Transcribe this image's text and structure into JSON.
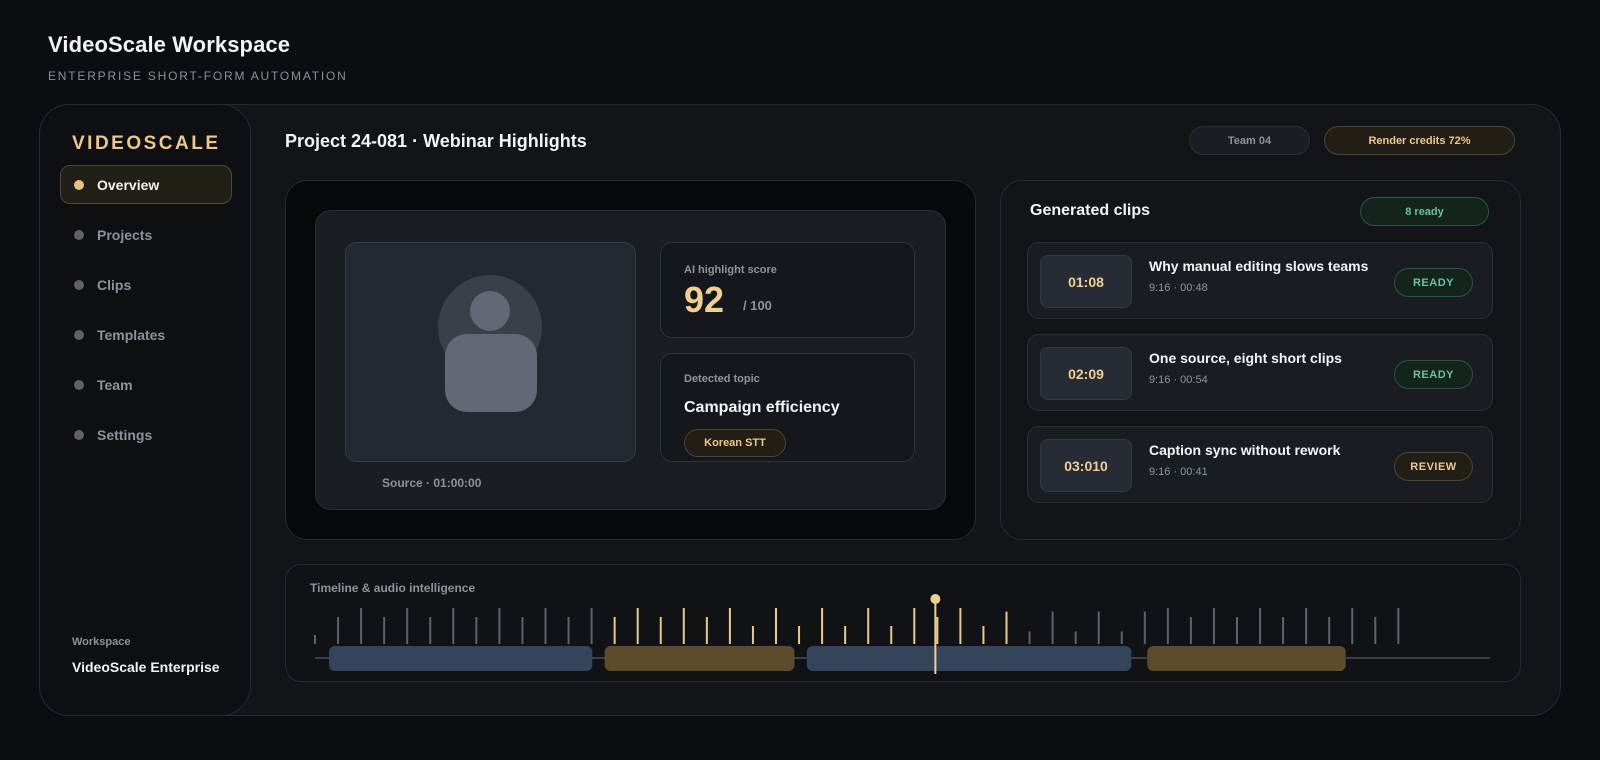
{
  "header": {
    "title": "VideoScale Workspace",
    "subtitle": "ENTERPRISE SHORT-FORM AUTOMATION"
  },
  "sidebar": {
    "brand": "VIDEOSCALE",
    "items": [
      {
        "label": "Overview",
        "active": true
      },
      {
        "label": "Projects",
        "active": false
      },
      {
        "label": "Clips",
        "active": false
      },
      {
        "label": "Templates",
        "active": false
      },
      {
        "label": "Team",
        "active": false
      },
      {
        "label": "Settings",
        "active": false
      }
    ],
    "workspace_label": "Workspace",
    "workspace_name": "VideoScale Enterprise"
  },
  "project": {
    "title": "Project 24-081 · Webinar Highlights",
    "team": "Team 04",
    "credits": "Render credits 72%",
    "source": "Source · 01:00:00",
    "score_label": "AI highlight score",
    "score_value": "92",
    "score_max": "/ 100",
    "topic_label": "Detected topic",
    "topic_value": "Campaign efficiency",
    "topic_chip": "Korean STT"
  },
  "clips": {
    "title": "Generated clips",
    "ready_badge": "8 ready",
    "items": [
      {
        "time": "01:08",
        "title": "Why manual editing slows teams",
        "meta": "9:16 · 00:48",
        "status": "READY",
        "status_kind": "ready"
      },
      {
        "time": "02:09",
        "title": "One source, eight short clips",
        "meta": "9:16 · 00:54",
        "status": "READY",
        "status_kind": "ready"
      },
      {
        "time": "03:010",
        "title": "Caption sync without rework",
        "meta": "9:16 · 00:41",
        "status": "REVIEW",
        "status_kind": "review"
      }
    ]
  },
  "timeline": {
    "title": "Timeline & audio intelligence",
    "bars": [
      {
        "level": 0.25,
        "highlight": false
      },
      {
        "level": 0.75,
        "highlight": false
      },
      {
        "level": 1.0,
        "highlight": false
      },
      {
        "level": 0.75,
        "highlight": false
      },
      {
        "level": 1.0,
        "highlight": false
      },
      {
        "level": 0.75,
        "highlight": false
      },
      {
        "level": 1.0,
        "highlight": false
      },
      {
        "level": 0.75,
        "highlight": false
      },
      {
        "level": 1.0,
        "highlight": false
      },
      {
        "level": 0.75,
        "highlight": false
      },
      {
        "level": 1.0,
        "highlight": false
      },
      {
        "level": 0.75,
        "highlight": false
      },
      {
        "level": 1.0,
        "highlight": false
      },
      {
        "level": 0.75,
        "highlight": true
      },
      {
        "level": 1.0,
        "highlight": true
      },
      {
        "level": 0.75,
        "highlight": true
      },
      {
        "level": 1.0,
        "highlight": true
      },
      {
        "level": 0.75,
        "highlight": true
      },
      {
        "level": 1.0,
        "highlight": true
      },
      {
        "level": 0.5,
        "highlight": true
      },
      {
        "level": 1.0,
        "highlight": true
      },
      {
        "level": 0.5,
        "highlight": true
      },
      {
        "level": 1.0,
        "highlight": true
      },
      {
        "level": 0.5,
        "highlight": true
      },
      {
        "level": 1.0,
        "highlight": true
      },
      {
        "level": 0.5,
        "highlight": true
      },
      {
        "level": 1.0,
        "highlight": true
      },
      {
        "level": 0.75,
        "highlight": true
      },
      {
        "level": 1.0,
        "highlight": true
      },
      {
        "level": 0.5,
        "highlight": true
      },
      {
        "level": 0.9,
        "highlight": true
      },
      {
        "level": 0.35,
        "highlight": false
      },
      {
        "level": 0.9,
        "highlight": false
      },
      {
        "level": 0.35,
        "highlight": false
      },
      {
        "level": 0.9,
        "highlight": false
      },
      {
        "level": 0.35,
        "highlight": false
      },
      {
        "level": 0.9,
        "highlight": false
      },
      {
        "level": 1.0,
        "highlight": false
      },
      {
        "level": 0.75,
        "highlight": false
      },
      {
        "level": 1.0,
        "highlight": false
      },
      {
        "level": 0.75,
        "highlight": false
      },
      {
        "level": 1.0,
        "highlight": false
      },
      {
        "level": 0.75,
        "highlight": false
      },
      {
        "level": 1.0,
        "highlight": false
      },
      {
        "level": 0.75,
        "highlight": false
      },
      {
        "level": 1.0,
        "highlight": false
      },
      {
        "level": 0.75,
        "highlight": false
      },
      {
        "level": 1.0,
        "highlight": false
      }
    ],
    "segments": [
      {
        "kind": "speech",
        "start": 0.0,
        "end": 0.215
      },
      {
        "kind": "highlight",
        "start": 0.225,
        "end": 0.38
      },
      {
        "kind": "speech",
        "start": 0.39,
        "end": 0.655
      },
      {
        "kind": "highlight",
        "start": 0.668,
        "end": 0.83
      }
    ],
    "playhead": 0.495
  },
  "colors": {
    "accent": "#ecc98a",
    "speech_segment": "#33445b",
    "highlight_segment": "#5c4c2b",
    "ready": "#6bc39a",
    "bar_normal": "#5d626c"
  }
}
